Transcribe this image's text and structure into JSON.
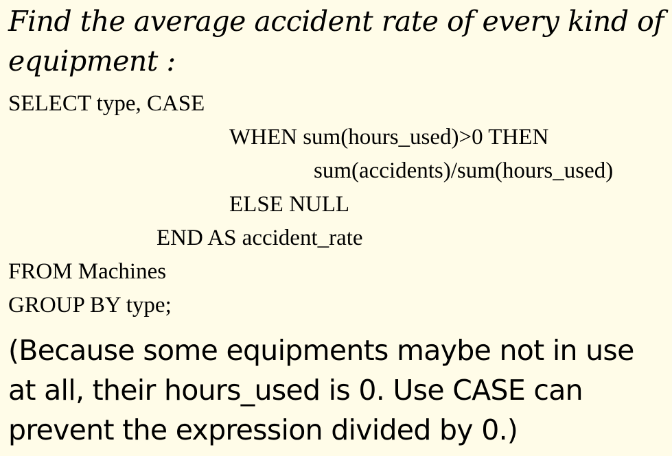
{
  "heading": "Find the average accident rate of every kind of equipment :",
  "code_lines": [
    "SELECT type, CASE",
    "WHEN sum(hours_used)>0 THEN",
    "sum(accidents)/sum(hours_used)",
    "ELSE NULL",
    "END AS accident_rate",
    "FROM Machines",
    "GROUP BY type;"
  ],
  "note": "(Because some equipments maybe not in use at all, their hours_used is 0. Use CASE can prevent the expression divided by 0.)",
  "colors": {
    "background": "#FFFCE8",
    "text": "#000000"
  }
}
